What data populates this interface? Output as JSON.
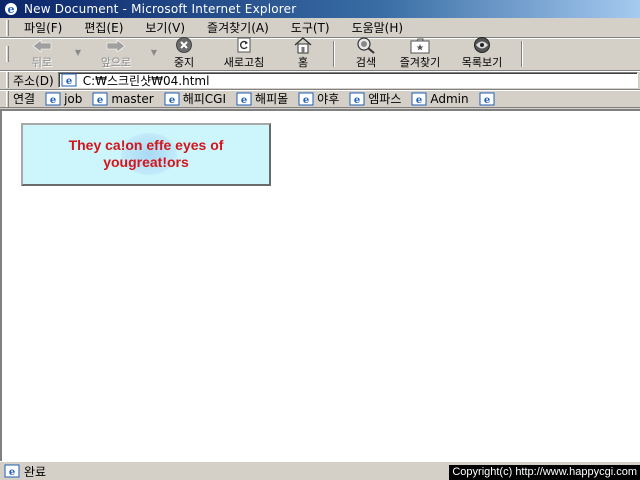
{
  "window": {
    "title": "New Document - Microsoft Internet Explorer"
  },
  "menu": [
    "파일(F)",
    "편집(E)",
    "보기(V)",
    "즐겨찾기(A)",
    "도구(T)",
    "도움말(H)"
  ],
  "toolbar": {
    "back": "뒤로",
    "forward": "앞으로",
    "stop": "중지",
    "refresh": "새로고침",
    "home": "홈",
    "search": "검색",
    "favorites": "즐겨찾기",
    "history": "목록보기"
  },
  "address": {
    "label": "주소(D)",
    "url": "C:₩스크린샷₩04.html"
  },
  "links": {
    "label": "연결",
    "items": [
      "job",
      "master",
      "해피CGI",
      "해피몰",
      "야후",
      "엠파스",
      "Admin",
      ""
    ]
  },
  "banner": {
    "line1": "They ca!on effe eyes of",
    "line2": "yougreat!ors",
    "color": "#d4141a",
    "background": "#ccf6fc"
  },
  "status": {
    "text": "완료",
    "copyright": "Copyright(c) http://www.happycgi.com"
  }
}
